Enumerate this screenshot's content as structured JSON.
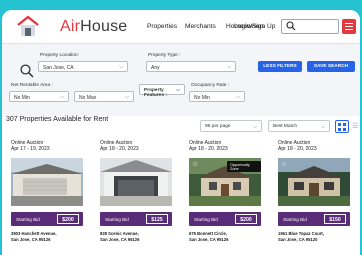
{
  "brand": {
    "part1": "Air",
    "part2": "House"
  },
  "nav": {
    "properties": "Properties",
    "merchants": "Merchants",
    "homeowners": "Homeowners",
    "login": "Login/Sign Up"
  },
  "filters": {
    "location_label": "Property Location:",
    "location_value": "San Jose, CA",
    "type_label": "Property Type :",
    "type_value": "Any",
    "less_filters": "LESS FILTERS",
    "save_search": "SAVE SEARCH",
    "area_label": "Net Rentable Area :",
    "area_min": "No Min",
    "area_max": "No Max",
    "features_label": "Property Features :",
    "occupancy_label": "Occupancy Rate :",
    "occupancy_min": "No Min"
  },
  "results": {
    "count_text": "307 Properties Available for Rent",
    "per_page": "96 per page",
    "sort": "Best Match"
  },
  "cards": [
    {
      "title": "Online Auction",
      "dates": "Apr 17 - 19, 2023",
      "bid_label": "Starting Bid",
      "amount": "$200",
      "addr1": "3903 Hanchett Avenue,",
      "addr2": "San Jose, CA 95126",
      "badge": ""
    },
    {
      "title": "Online Auction",
      "dates": "Apr 18 - 20, 2023",
      "bid_label": "Starting Bid",
      "amount": "$125",
      "addr1": "828 Scenic Avenue,",
      "addr2": "San Jose, CA 95126",
      "badge": ""
    },
    {
      "title": "Online Auction",
      "dates": "Apr 18 - 20, 2023",
      "bid_label": "Starting Bid",
      "amount": "$200",
      "addr1": "675 Bonnett Circle,",
      "addr2": "San Jose, CA 95126",
      "badge": "Opportunity Zone"
    },
    {
      "title": "Online Auction",
      "dates": "Apr 18 - 20, 2023",
      "bid_label": "Starting Bid",
      "amount": "$150",
      "addr1": "1961 Blue Topaz Court,",
      "addr2": "San Jose, CA 95120",
      "badge": ""
    }
  ]
}
